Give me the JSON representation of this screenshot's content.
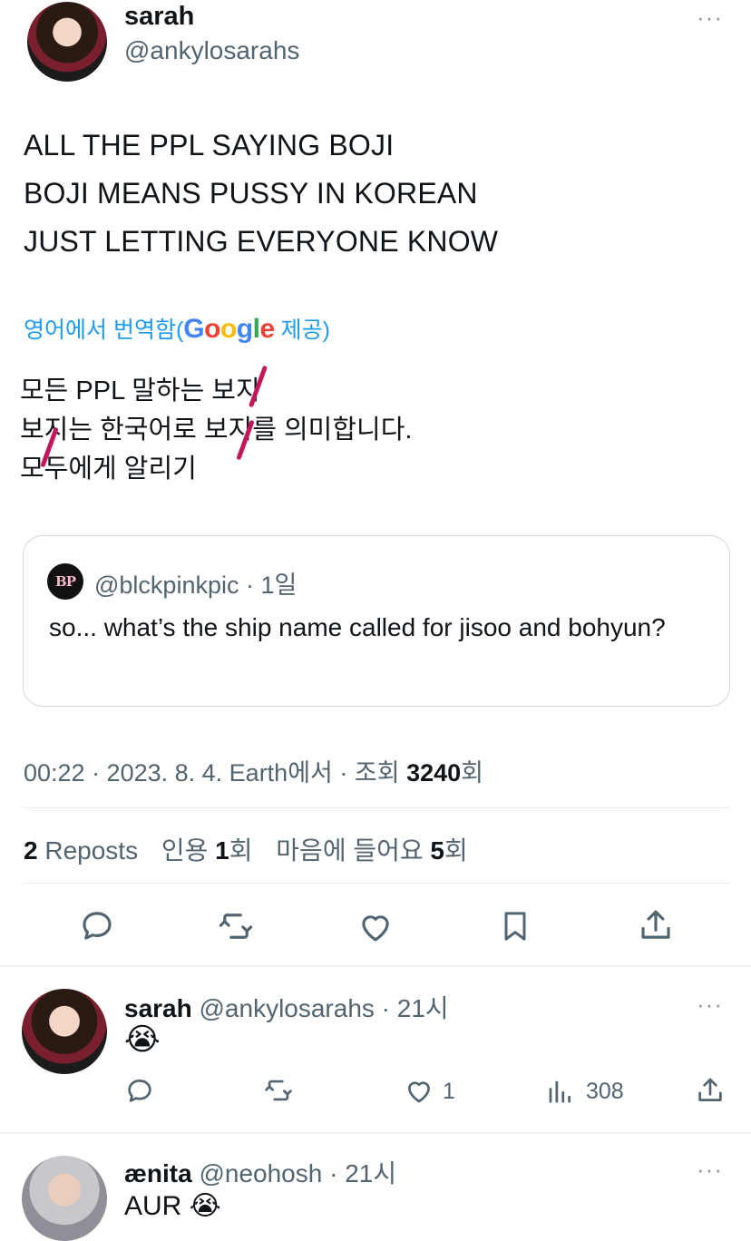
{
  "author": {
    "name": "sarah",
    "handle": "@ankylosarahs"
  },
  "tweet": {
    "lines": [
      "ALL THE PPL SAYING BOJI",
      "BOJI MEANS PUSSY IN KOREAN",
      "JUST LETTING EVERYONE KNOW"
    ],
    "translate": {
      "prefix": "영어에서 번역함(",
      "google": [
        "G",
        "o",
        "o",
        "g",
        "l",
        "e"
      ],
      "suffix": " 제공)"
    },
    "translation_lines": [
      "모든 PPL 말하는 보지",
      "보지는 한국어로 보지를 의미합니다.",
      "모두에게 알리기"
    ]
  },
  "quote": {
    "logo": "BP",
    "handle": "@blckpinkpic",
    "time": " · 1일",
    "text": "so... what’s the ship name called for jisoo and bohyun?"
  },
  "meta": {
    "time": "00:22 · 2023. 8. 4. Earth에서 · 조회 ",
    "views": "3240",
    "views_suffix": "회"
  },
  "stats": {
    "reposts_count": "2",
    "reposts_label": " Reposts",
    "quotes_label": "인용 ",
    "quotes_count": "1",
    "quotes_suffix": "회",
    "likes_label": "마음에 들어요 ",
    "likes_count": "5",
    "likes_suffix": "회"
  },
  "more_icon": "···",
  "replies": [
    {
      "name": "sarah",
      "handle": "@ankylosarahs",
      "time": " · 21시",
      "text": "😭",
      "likes": "1",
      "views": "308"
    },
    {
      "name": "ænita",
      "handle": "@neohosh",
      "time": " · 21시",
      "text": "AUR 😭"
    }
  ],
  "icons": [
    "reply-icon",
    "repost-icon",
    "like-icon",
    "bookmark-icon",
    "share-icon",
    "views-icon",
    "more-icon"
  ],
  "colors": {
    "link": "#1d9bf0",
    "text": "#0f1419",
    "muted": "#536471",
    "annotation": "#c2185b"
  }
}
